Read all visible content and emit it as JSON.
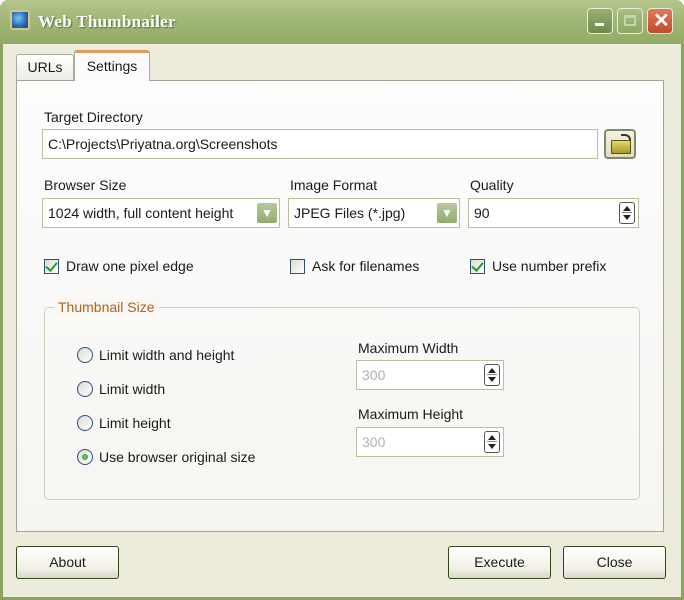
{
  "window": {
    "title": "Web Thumbnailer",
    "icon": "globe-icon",
    "controls": {
      "minimize": "minimize-icon",
      "maximize": "maximize-icon",
      "close": "close-icon"
    }
  },
  "tabs": [
    {
      "label": "URLs",
      "active": false
    },
    {
      "label": "Settings",
      "active": true
    }
  ],
  "settings": {
    "target_directory": {
      "label": "Target Directory",
      "value": "C:\\Projects\\Priyatna.org\\Screenshots",
      "browse_icon": "folder-open-icon"
    },
    "browser_size": {
      "label": "Browser Size",
      "value": "1024 width, full content height"
    },
    "image_format": {
      "label": "Image Format",
      "value": "JPEG Files (*.jpg)"
    },
    "quality": {
      "label": "Quality",
      "value": "90"
    },
    "checkboxes": [
      {
        "label": "Draw one pixel edge",
        "checked": true
      },
      {
        "label": "Ask for filenames",
        "checked": false
      },
      {
        "label": "Use number prefix",
        "checked": true
      }
    ],
    "thumbnail_size": {
      "title": "Thumbnail Size",
      "options": [
        {
          "label": "Limit width and height",
          "selected": false
        },
        {
          "label": "Limit width",
          "selected": false
        },
        {
          "label": "Limit height",
          "selected": false
        },
        {
          "label": "Use browser original size",
          "selected": true
        }
      ],
      "max_width": {
        "label": "Maximum Width",
        "value": "300",
        "enabled": false
      },
      "max_height": {
        "label": "Maximum Height",
        "value": "300",
        "enabled": false
      }
    }
  },
  "buttons": {
    "about": "About",
    "execute": "Execute",
    "close": "Close"
  },
  "colors": {
    "titlebar": "#a3b879",
    "group_title": "#b0631b",
    "active_tab_accent": "#e59a5d",
    "check_green": "#21a121"
  }
}
